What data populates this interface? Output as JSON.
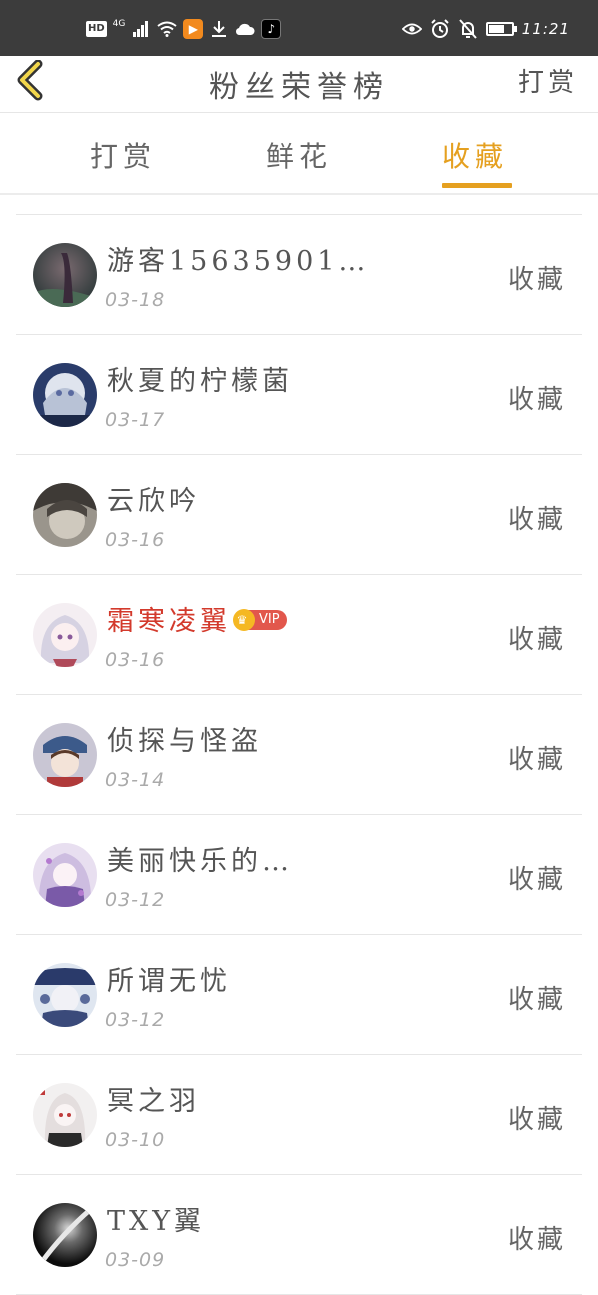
{
  "status_bar": {
    "hd": "HD",
    "network": "4G",
    "time": "11:21",
    "battery_level": 0.65
  },
  "header": {
    "title": "粉丝荣誉榜",
    "right_action": "打赏"
  },
  "tabs": [
    {
      "label": "打赏",
      "active": false
    },
    {
      "label": "鲜花",
      "active": false
    },
    {
      "label": "收藏",
      "active": true
    }
  ],
  "list": [
    {
      "name": "游客15635901…",
      "date": "03-18",
      "action": "收藏",
      "vip": false
    },
    {
      "name": "秋夏的柠檬菌",
      "date": "03-17",
      "action": "收藏",
      "vip": false
    },
    {
      "name": "云欣吟",
      "date": "03-16",
      "action": "收藏",
      "vip": false
    },
    {
      "name": "霜寒凌翼",
      "date": "03-16",
      "action": "收藏",
      "vip": true,
      "vip_label": "VIP"
    },
    {
      "name": "侦探与怪盗",
      "date": "03-14",
      "action": "收藏",
      "vip": false
    },
    {
      "name": "美丽快乐的…",
      "date": "03-12",
      "action": "收藏",
      "vip": false
    },
    {
      "name": "所谓无忧",
      "date": "03-12",
      "action": "收藏",
      "vip": false
    },
    {
      "name": "冥之羽",
      "date": "03-10",
      "action": "收藏",
      "vip": false
    },
    {
      "name": "TXY翼",
      "date": "03-09",
      "action": "收藏",
      "vip": false
    }
  ],
  "colors": {
    "accent": "#e5a020",
    "vip_name": "#d33a2c"
  }
}
